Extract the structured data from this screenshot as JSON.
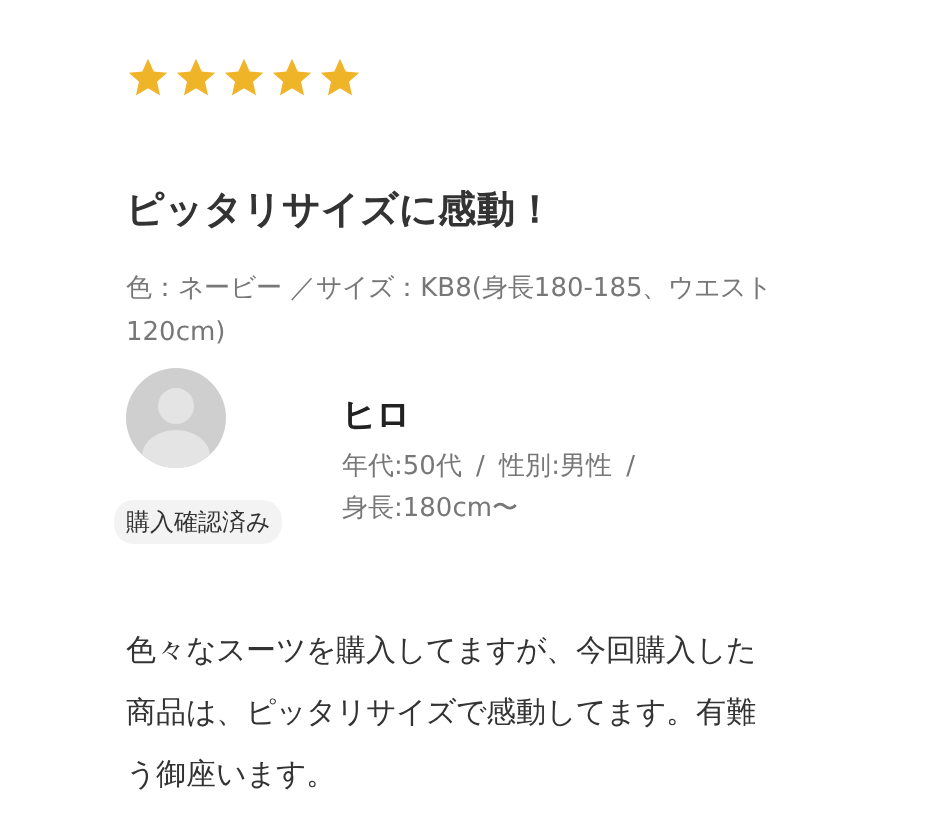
{
  "review": {
    "stars": 5,
    "title": "ピッタリサイズに感動！",
    "variant": "色：ネービー ／サイズ：KB8(身長180-185、ウエスト120cm)",
    "reviewer": {
      "name": "ヒロ",
      "meta": "年代:50代 / 性別:男性 / 身長:180cm〜",
      "badge": "購入確認済み"
    },
    "body": "色々なスーツを購入してますが、今回購入した商品は、ピッタリサイズで感動してます。有難う御座います。"
  }
}
